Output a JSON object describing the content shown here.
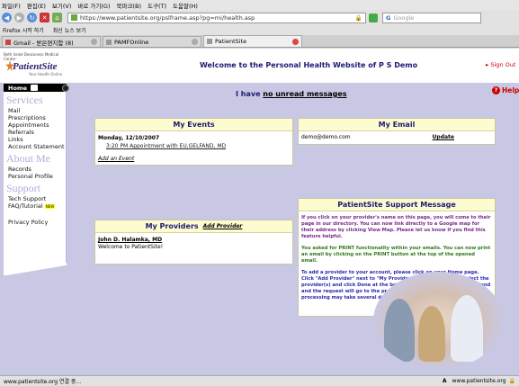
{
  "browser": {
    "menu": [
      "파일(F)",
      "편집(E)",
      "보기(V)",
      "바로 가기(G)",
      "북마크(B)",
      "도구(T)",
      "도움말(H)"
    ],
    "url": "https://www.patientsite.org/pslframe.asp?pg=mi/health.asp",
    "search_placeholder": "Google",
    "bookmarks": [
      "Firefox 시작 하기",
      "최신 뉴스 보기"
    ],
    "tabs": [
      "Gmail - 받은편지함 (8)",
      "PAMFOnline",
      "PatientSite"
    ],
    "status_left": "www.patientsite.org 연결 중...",
    "status_right": "www.patientsite.org"
  },
  "header": {
    "logo_small": "Beth Israel Deaconess Medical Center",
    "logo_name": "PatientSite",
    "logo_tag": "Your Health Online",
    "welcome": "Welcome to the Personal Health Website of P S Demo",
    "signout": "Sign Out"
  },
  "sidebar": {
    "home": "Home",
    "services_title": "Services",
    "services": [
      "Mail",
      "Prescriptions",
      "Appointments",
      "Referrals",
      "Links",
      "Account Statement"
    ],
    "about_title": "About Me",
    "about": [
      "Records",
      "Personal Profile"
    ],
    "support_title": "Support",
    "support": [
      "Tech Support",
      "FAQ/Tutorial"
    ],
    "new_badge": "NEW",
    "privacy": "Privacy Policy"
  },
  "main": {
    "unread_prefix": "I have",
    "unread_link": "no unread messages",
    "help": "Help",
    "events": {
      "title": "My Events",
      "date": "Monday, 12/10/2007",
      "appointment": "3:20 PM Appointment with EU,GELFAND, MD",
      "add": "Add an Event"
    },
    "providers": {
      "title": "My Providers",
      "add": "Add Provider",
      "name": "John D. Halamka, MD",
      "message": "Welcome to PatientSite!"
    },
    "email": {
      "title": "My Email",
      "address": "demo@demo.com",
      "update": "Update"
    },
    "support": {
      "title": "PatientSite Support Message",
      "p1": "If you click on your provider's name on this page, you will come to their page in our directory. You can now link directly to a Google map for their address by clicking View Map. Please let us know if you find this feature helpful.",
      "p2": "You asked for PRINT functionality within your emails. You can now print an email by clicking on the PRINT button at the top of the opened email.",
      "p3": "To add a provider to your account, please click on your Home page. Click \"Add Provider\" next to \"My Providers\". You will need to select the provider(s) and click Done at the bottom of the provider list. Click Send and the request will go to the provider(s) office to be processed. The processing may take several days."
    }
  }
}
